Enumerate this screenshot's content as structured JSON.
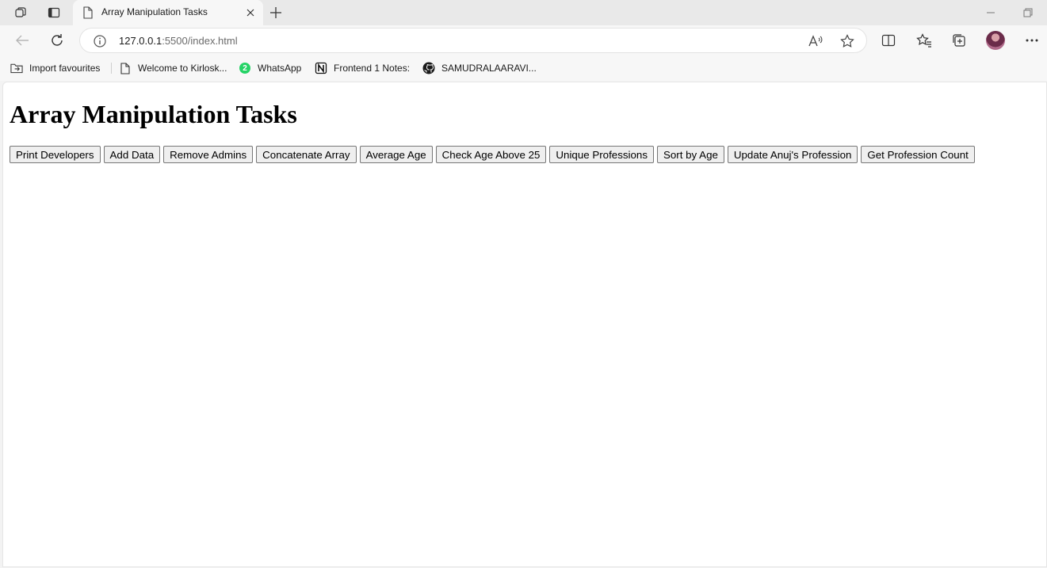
{
  "tab": {
    "title": "Array Manipulation Tasks"
  },
  "address": {
    "host": "127.0.0.1",
    "rest": ":5500/index.html"
  },
  "favorites": [
    {
      "label": "Import favourites",
      "icon": "import-folder-icon"
    },
    {
      "label": "Welcome to Kirlosk...",
      "icon": "page-icon"
    },
    {
      "label": "WhatsApp",
      "icon": "whatsapp-icon",
      "badge": "2"
    },
    {
      "label": "Frontend 1 Notes:",
      "icon": "notion-icon"
    },
    {
      "label": "SAMUDRALAARAVI...",
      "icon": "github-icon"
    }
  ],
  "page": {
    "heading": "Array Manipulation Tasks",
    "buttons": [
      "Print Developers",
      "Add Data",
      "Remove Admins",
      "Concatenate Array",
      "Average Age",
      "Check Age Above 25",
      "Unique Professions",
      "Sort by Age",
      "Update Anuj's Profession",
      "Get Profession Count"
    ]
  },
  "colors": {
    "accent": "#1a73e8",
    "whatsapp": "#25d366",
    "page_bg": "#ffffff",
    "chrome_bg": "#f7f7f7"
  }
}
